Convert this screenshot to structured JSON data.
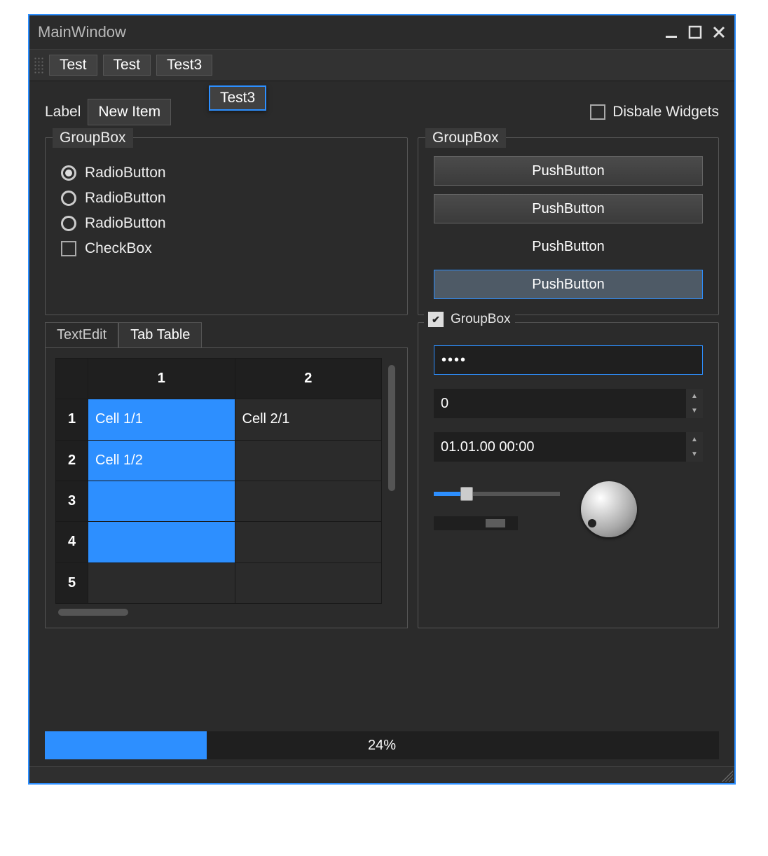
{
  "window": {
    "title": "MainWindow"
  },
  "toolbar": {
    "items": [
      "Test",
      "Test",
      "Test3"
    ]
  },
  "top": {
    "label": "Label",
    "combo_value": "New Item",
    "popup_value": "Test3",
    "disable_label": "Disbale Widgets",
    "disable_checked": false
  },
  "group_left": {
    "title": "GroupBox",
    "radios": [
      "RadioButton",
      "RadioButton",
      "RadioButton"
    ],
    "radio_selected": 0,
    "check_label": "CheckBox"
  },
  "group_right": {
    "title": "GroupBox",
    "buttons": [
      "PushButton",
      "PushButton",
      "PushButton",
      "PushButton"
    ]
  },
  "tabs": {
    "t0": "TextEdit",
    "t1": "Tab Table",
    "active": 1
  },
  "table": {
    "headers": [
      "1",
      "2"
    ],
    "rows": [
      {
        "n": "1",
        "c0": "Cell 1/1",
        "c1": "Cell 2/1",
        "sel": [
          true,
          false
        ]
      },
      {
        "n": "2",
        "c0": "Cell 1/2",
        "c1": "",
        "sel": [
          true,
          false
        ]
      },
      {
        "n": "3",
        "c0": "",
        "c1": "",
        "sel": [
          true,
          false
        ]
      },
      {
        "n": "4",
        "c0": "",
        "c1": "",
        "sel": [
          true,
          false
        ]
      },
      {
        "n": "5",
        "c0": "",
        "c1": "",
        "sel": [
          false,
          false
        ]
      }
    ]
  },
  "group_form": {
    "title": "GroupBox",
    "checked": true,
    "password_mask": "••••",
    "spin_value": "0",
    "datetime_value": "01.01.00 00:00"
  },
  "progress": {
    "value": 24,
    "text": "24%"
  },
  "colors": {
    "accent": "#2d8fff"
  }
}
